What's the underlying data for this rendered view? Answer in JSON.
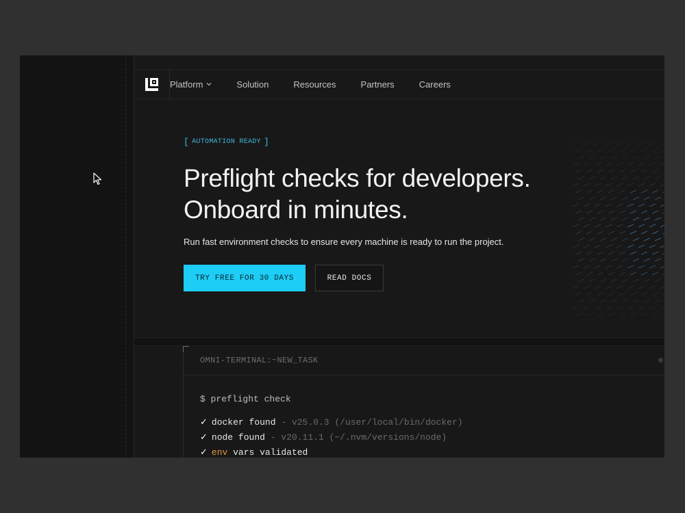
{
  "nav": {
    "items": [
      {
        "label": "Platform",
        "has_dropdown": true
      },
      {
        "label": "Solution"
      },
      {
        "label": "Resources"
      },
      {
        "label": "Partners"
      },
      {
        "label": "Careers"
      }
    ]
  },
  "hero": {
    "badge": "AUTOMATION READY",
    "headline_line1": "Preflight checks for developers.",
    "headline_line2": "Onboard in minutes.",
    "subtext": "Run fast environment checks to ensure every machine is ready to run the project.",
    "primary_cta": "TRY FREE FOR 30 DAYS",
    "secondary_cta": "READ DOCS"
  },
  "terminal": {
    "title": "OMNI-TERMINAL:~NEW_TASK",
    "command": "$ preflight check",
    "lines": [
      {
        "check": "✓",
        "name": "docker found",
        "detail": "- v25.0.3 (/user/local/bin/docker)"
      },
      {
        "check": "✓",
        "name": "node found",
        "detail": "- v20.11.1 (~/.nvm/versions/node)"
      },
      {
        "check": "✓",
        "env": "env",
        "name": "vars validated"
      }
    ]
  },
  "colors": {
    "accent": "#1dcdf5",
    "badge": "#3fb9e0",
    "background": "#181818",
    "env_highlight": "#e29a3f"
  },
  "icons": {
    "logo": "brand-logo-icon",
    "dropdown": "chevron-down-icon",
    "cursor": "mouse-pointer-icon"
  }
}
